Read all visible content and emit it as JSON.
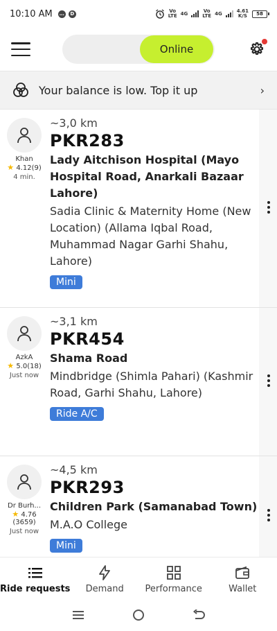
{
  "status_bar": {
    "time": "10:10 AM",
    "left_icons": [
      "chat-notification-icon",
      "d-app-icon"
    ],
    "net1": "Vo\nLTE",
    "net1_type": "4G",
    "net2": "Vo\nLTE",
    "net2_type": "4G",
    "speed": "4.61\nK/S",
    "battery": "58"
  },
  "header": {
    "status_label": "Online",
    "status_color": "#c6ef2f",
    "notification_color": "#e53935"
  },
  "banner": {
    "text": "Your balance is low. Top it up"
  },
  "requests": [
    {
      "rider_name": "Khan",
      "rating": "4.12",
      "rating_count": "(9)",
      "time_ago": "4 min.",
      "distance": "~3,0 km",
      "price": "PKR283",
      "pickup": "Lady Aitchison Hospital (Mayo Hospital Road, Anarkali Bazaar Lahore)",
      "dropoff": "Sadia Clinic & Maternity Home (New Location) (Allama Iqbal Road, Muhammad Nagar Garhi Shahu, Lahore)",
      "category": "Mini"
    },
    {
      "rider_name": "AzkA",
      "rating": "5.0",
      "rating_count": "(18)",
      "time_ago": "Just now",
      "distance": "~3,1 km",
      "price": "PKR454",
      "pickup": "Shama Road",
      "dropoff": "Mindbridge (Shimla Pahari) (Kashmir Road, Garhi Shahu, Lahore)",
      "category": "Ride A/C"
    },
    {
      "rider_name": "Dr Burh...",
      "rating": "4.76",
      "rating_count": "(3659)",
      "time_ago": "Just now",
      "distance": "~4,5 km",
      "price": "PKR293",
      "pickup": "Children Park (Samanabad Town)",
      "dropoff": "M.A.O College",
      "category": "Mini"
    }
  ],
  "bottom_nav": {
    "items": [
      {
        "label": "Ride requests",
        "icon": "list-icon",
        "active": true
      },
      {
        "label": "Demand",
        "icon": "lightning-icon",
        "active": false
      },
      {
        "label": "Performance",
        "icon": "grid-icon",
        "active": false
      },
      {
        "label": "Wallet",
        "icon": "wallet-icon",
        "active": false
      }
    ]
  },
  "colors": {
    "category_badge": "#3e7cd9",
    "star": "#f5b800"
  }
}
